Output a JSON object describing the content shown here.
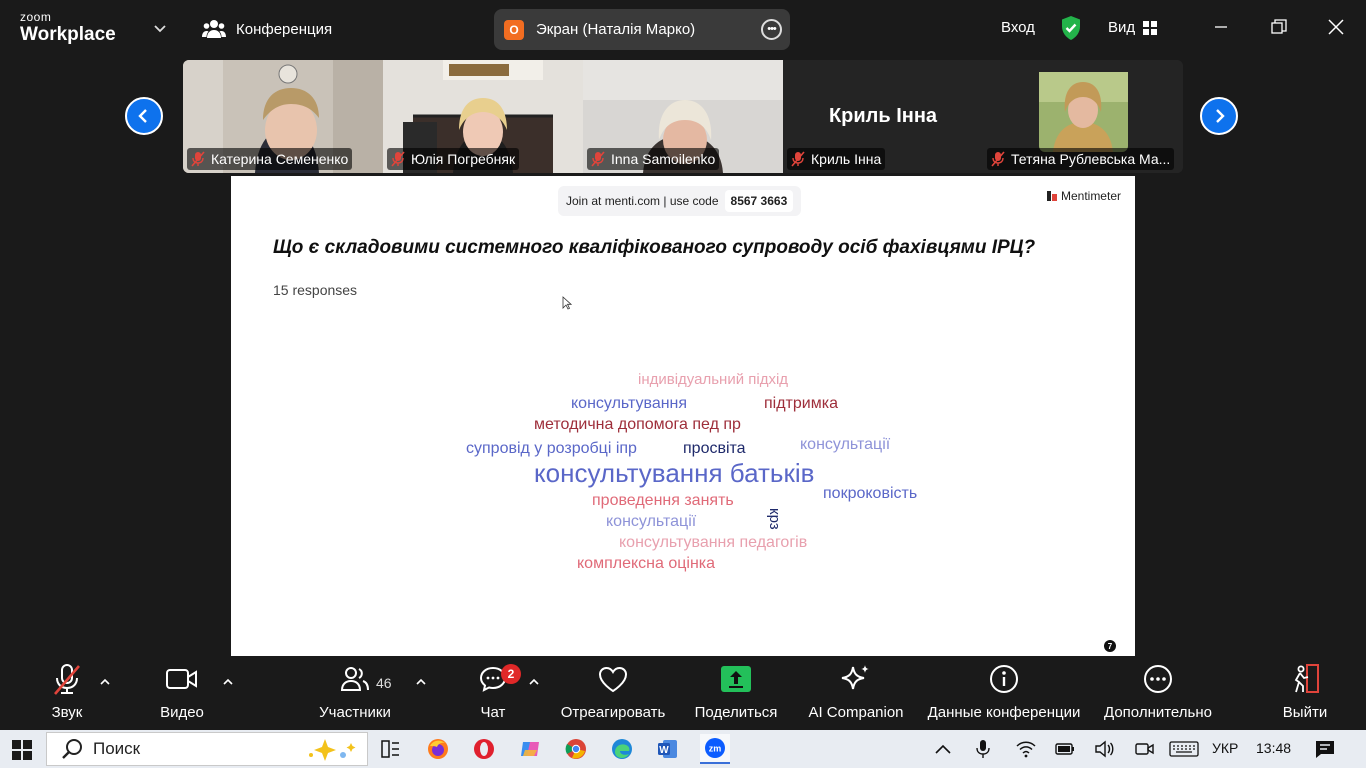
{
  "app": {
    "logo_line1": "zoom",
    "logo_line2": "Workplace",
    "conference_label": "Конференция",
    "screen_badge": "O",
    "screen_label": "Экран (Наталія Марко)",
    "login_label": "Вход",
    "view_label": "Вид"
  },
  "participants_strip": [
    {
      "name": "Катерина Семененко"
    },
    {
      "name": "Юлія Погребняк"
    },
    {
      "name": "Inna Samoilenko"
    },
    {
      "name": "Криль Інна",
      "big_name": "Криль Інна"
    },
    {
      "name": "Тетяна Рублевська Ма..."
    }
  ],
  "slide": {
    "join_text": "Join at menti.com | use code",
    "join_code": "8567 3663",
    "brand": "Mentimeter",
    "question": "Що є складовими системного кваліфікованого супроводу осіб фахівцями ІРЦ?",
    "responses": "15 responses",
    "page_number": "7",
    "words": [
      {
        "text": "індивідуальний підхід",
        "color": "#e8a0ae"
      },
      {
        "text": "консультування",
        "color": "#5a67c8"
      },
      {
        "text": "підтримка",
        "color": "#9e2e3a"
      },
      {
        "text": "методична допомога пед пр",
        "color": "#9e2e3a"
      },
      {
        "text": "супровід у розробці іпр",
        "color": "#5a67c8"
      },
      {
        "text": "просвіта",
        "color": "#1f2a6b"
      },
      {
        "text": "консультації",
        "color": "#8e93d8"
      },
      {
        "text": "консультування батьків",
        "color": "#5a67c8"
      },
      {
        "text": "проведення занять",
        "color": "#e06a78"
      },
      {
        "text": "покроковість",
        "color": "#5a67c8"
      },
      {
        "text": "консультації",
        "color": "#8e93d8"
      },
      {
        "text": "крз",
        "color": "#1f2a6b"
      },
      {
        "text": "консультування педагогів",
        "color": "#e8a0ae"
      },
      {
        "text": "комплексна оцінка",
        "color": "#e06a78"
      }
    ]
  },
  "toolbar": {
    "audio": "Звук",
    "video": "Видео",
    "participants": "Участники",
    "participants_count": "46",
    "chat": "Чат",
    "chat_badge": "2",
    "react": "Отреагировать",
    "share": "Поделиться",
    "ai": "AI Companion",
    "info": "Данные конференции",
    "more": "Дополнительно",
    "leave": "Выйти"
  },
  "taskbar": {
    "search_placeholder": "Поиск",
    "language": "УКР",
    "time": "13:48"
  }
}
